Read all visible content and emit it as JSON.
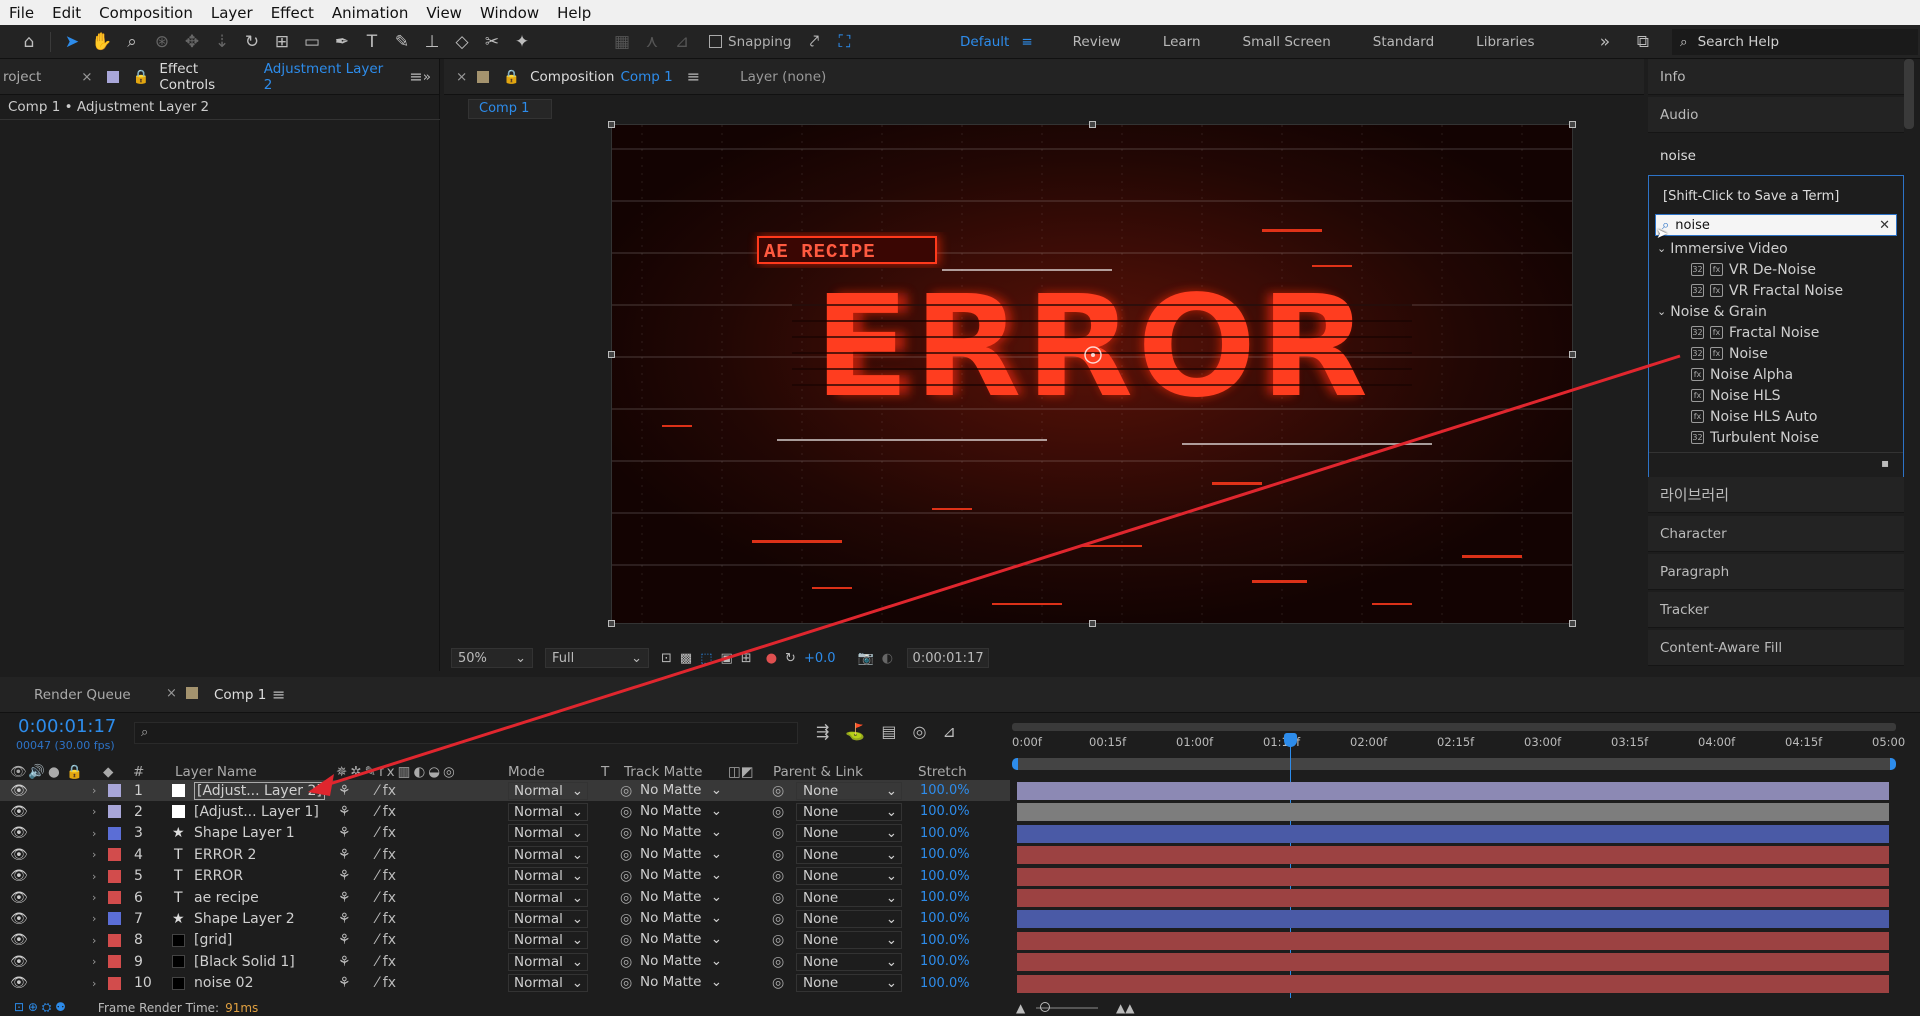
{
  "menu": [
    "File",
    "Edit",
    "Composition",
    "Layer",
    "Effect",
    "Animation",
    "View",
    "Window",
    "Help"
  ],
  "toolbar": {
    "snapping_label": "Snapping",
    "workspaces": [
      "Default",
      "Review",
      "Learn",
      "Small Screen",
      "Standard",
      "Libraries"
    ],
    "active_workspace": "Default",
    "search_help_placeholder": "Search Help"
  },
  "left_panel": {
    "project_tab": "roject",
    "effect_controls_tab": "Effect Controls",
    "effect_controls_layer": "Adjustment Layer 2",
    "breadcrumb": "Comp 1 • Adjustment Layer 2"
  },
  "viewer": {
    "comp_tab": "Composition",
    "comp_name": "Comp 1",
    "layer_tab": "Layer (none)",
    "sub_tab": "Comp 1",
    "zoom": "50%",
    "resolution": "Full",
    "exposure": "+0.0",
    "timecode": "0:00:01:17",
    "canvas": {
      "tag_text": "AE RECIPE",
      "main_text": "ERROR"
    }
  },
  "right_panels": {
    "info": "Info",
    "audio": "Audio",
    "effects_search": "noise",
    "save_hint": "[Shift-Click to Save a Term]",
    "filter_value": "noise",
    "groups": [
      {
        "name": "Immersive Video",
        "items": [
          "VR De-Noise",
          "VR Fractal Noise"
        ]
      },
      {
        "name": "Noise & Grain",
        "items": [
          "Fractal Noise",
          "Noise",
          "Noise Alpha",
          "Noise HLS",
          "Noise HLS Auto",
          "Turbulent Noise"
        ]
      }
    ],
    "libraries": "라이브러리",
    "character": "Character",
    "paragraph": "Paragraph",
    "tracker": "Tracker",
    "content_aware": "Content-Aware Fill"
  },
  "timeline": {
    "render_queue_tab": "Render Queue",
    "comp_tab": "Comp 1",
    "timecode": "0:00:01:17",
    "frames": "00047 (30.00 fps)",
    "columns": {
      "num": "#",
      "layer_name": "Layer Name",
      "mode": "Mode",
      "t": "T",
      "track_matte": "Track Matte",
      "parent": "Parent & Link",
      "stretch": "Stretch"
    },
    "ruler": [
      "0:00f",
      "00:15f",
      "01:00f",
      "01:15f",
      "02:00f",
      "02:15f",
      "03:00f",
      "03:15f",
      "04:00f",
      "04:15f",
      "05:00"
    ],
    "layers": [
      {
        "num": "1",
        "name": "[Adjust... Layer 2]",
        "type": "solid",
        "label": "#a8a6d8",
        "mode": "Normal",
        "matte": "No Matte",
        "parent": "None",
        "stretch": "100.0%",
        "bar": "#8c89b4",
        "selected": true
      },
      {
        "num": "2",
        "name": "[Adjust... Layer 1]",
        "type": "solid",
        "label": "#a8a6d8",
        "mode": "Normal",
        "matte": "No Matte",
        "parent": "None",
        "stretch": "100.0%",
        "bar": "#7d7d7d",
        "selected": false
      },
      {
        "num": "3",
        "name": "Shape Layer 1",
        "type": "shape",
        "label": "#5b6ed6",
        "mode": "Normal",
        "matte": "No Matte",
        "parent": "None",
        "stretch": "100.0%",
        "bar": "#4a5aa6",
        "selected": false
      },
      {
        "num": "4",
        "name": "ERROR 2",
        "type": "text",
        "label": "#d24c4c",
        "mode": "Normal",
        "matte": "No Matte",
        "parent": "None",
        "stretch": "100.0%",
        "bar": "#9c4242",
        "selected": false
      },
      {
        "num": "5",
        "name": "ERROR",
        "type": "text",
        "label": "#d24c4c",
        "mode": "Normal",
        "matte": "No Matte",
        "parent": "None",
        "stretch": "100.0%",
        "bar": "#9c4242",
        "selected": false
      },
      {
        "num": "6",
        "name": "ae recipe",
        "type": "text",
        "label": "#d24c4c",
        "mode": "Normal",
        "matte": "No Matte",
        "parent": "None",
        "stretch": "100.0%",
        "bar": "#9c4242",
        "selected": false
      },
      {
        "num": "7",
        "name": "Shape Layer 2",
        "type": "shape",
        "label": "#5b6ed6",
        "mode": "Normal",
        "matte": "No Matte",
        "parent": "None",
        "stretch": "100.0%",
        "bar": "#4a5aa6",
        "selected": false
      },
      {
        "num": "8",
        "name": "[grid]",
        "type": "solid-black",
        "label": "#d24c4c",
        "mode": "Normal",
        "matte": "No Matte",
        "parent": "None",
        "stretch": "100.0%",
        "bar": "#9c4242",
        "selected": false
      },
      {
        "num": "9",
        "name": "[Black Solid 1]",
        "type": "solid-black",
        "label": "#d24c4c",
        "mode": "Normal",
        "matte": "No Matte",
        "parent": "None",
        "stretch": "100.0%",
        "bar": "#9c4242",
        "selected": false
      },
      {
        "num": "10",
        "name": "noise 02",
        "type": "solid-black",
        "label": "#d24c4c",
        "mode": "Normal",
        "matte": "No Matte",
        "parent": "None",
        "stretch": "100.0%",
        "bar": "#9c4242",
        "selected": false
      }
    ],
    "render_time_label": "Frame Render Time:",
    "render_time_value": "91ms"
  },
  "colors": {
    "accent": "#2d8ceb",
    "annotation_arrow": "#e0262e"
  }
}
